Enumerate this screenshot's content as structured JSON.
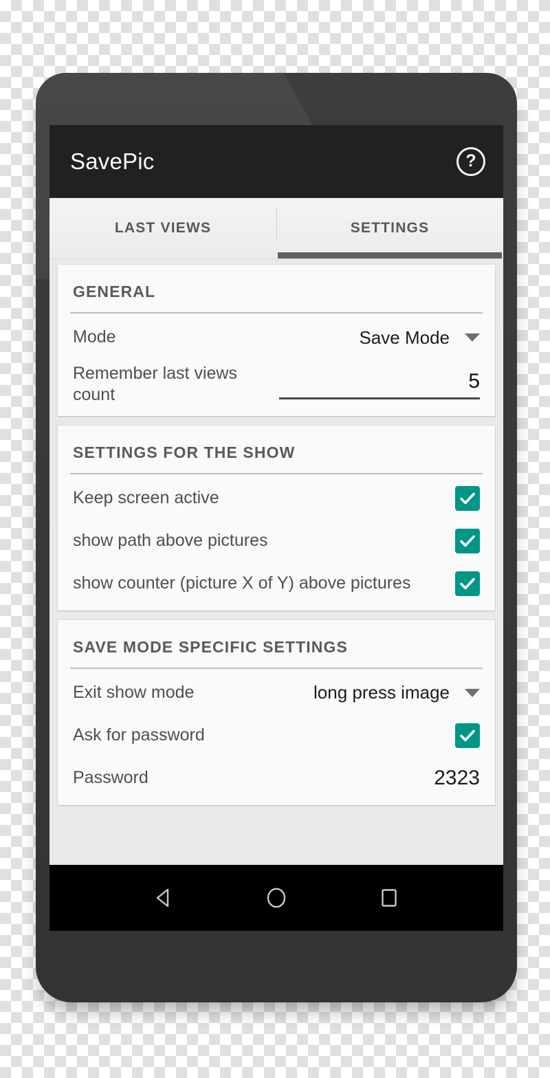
{
  "app": {
    "title": "SavePic",
    "help_icon": "help-circle-icon",
    "help_glyph": "?"
  },
  "tabs": [
    {
      "label": "LAST VIEWS",
      "selected": false
    },
    {
      "label": "SETTINGS",
      "selected": true
    }
  ],
  "sections": [
    {
      "title": "GENERAL",
      "rows": [
        {
          "type": "spinner",
          "label": "Mode",
          "value": "Save Mode"
        },
        {
          "type": "number",
          "label": "Remember last views count",
          "value": "5"
        }
      ]
    },
    {
      "title": "SETTINGS FOR THE SHOW",
      "rows": [
        {
          "type": "checkbox",
          "label": "Keep screen active",
          "checked": true
        },
        {
          "type": "checkbox",
          "label": "show path above pictures",
          "checked": true
        },
        {
          "type": "checkbox",
          "label": "show counter (picture X of Y) above pictures",
          "checked": true
        }
      ]
    },
    {
      "title": "SAVE MODE SPECIFIC SETTINGS",
      "rows": [
        {
          "type": "spinner",
          "label": "Exit show mode",
          "value": "long press image"
        },
        {
          "type": "checkbox",
          "label": "Ask for password",
          "checked": true
        },
        {
          "type": "text",
          "label": "Password",
          "value": "2323"
        }
      ]
    }
  ],
  "navbar": {
    "back": "back-triangle-icon",
    "home": "home-circle-icon",
    "recents": "recents-square-icon"
  },
  "colors": {
    "appbar": "#212121",
    "checkbox_accent": "#009688",
    "card": "#fafafa",
    "page_background": "#e9e9e9",
    "tab_indicator": "#616161",
    "bezel": "#3a3a3a"
  }
}
